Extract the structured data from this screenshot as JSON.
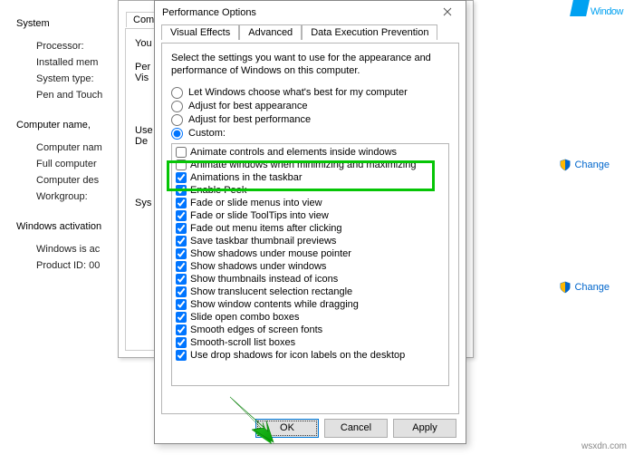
{
  "winlogo": "Window",
  "bg": {
    "system": "System",
    "rows1": [
      "Processor:",
      "Installed mem",
      "System type:",
      "Pen and Touch"
    ],
    "computer_name": "Computer name,",
    "rows2": [
      "Computer nam",
      "Full computer",
      "Computer des",
      "Workgroup:"
    ],
    "activation": "Windows activation",
    "rows3": [
      "Windows is ac",
      "Product ID:  00"
    ],
    "change": "Change"
  },
  "sys_props": {
    "tab": "Compu",
    "you": "You",
    "groups": [
      {
        "p1": "Per",
        "p2": "Vis"
      },
      {
        "p1": "Use",
        "p2": "De"
      },
      {
        "p1": "Sys"
      }
    ]
  },
  "perf": {
    "title": "Performance Options",
    "tabs": [
      "Visual Effects",
      "Advanced",
      "Data Execution Prevention"
    ],
    "desc": "Select the settings you want to use for the appearance and performance of Windows on this computer.",
    "radios": [
      "Let Windows choose what's best for my computer",
      "Adjust for best appearance",
      "Adjust for best performance",
      "Custom:"
    ],
    "selected_radio": 3,
    "options": [
      {
        "c": false,
        "t": "Animate controls and elements inside windows"
      },
      {
        "c": false,
        "t": "Animate windows when minimizing and maximizing"
      },
      {
        "c": true,
        "t": "Animations in the taskbar"
      },
      {
        "c": true,
        "t": "Enable Peek"
      },
      {
        "c": true,
        "t": "Fade or slide menus into view"
      },
      {
        "c": true,
        "t": "Fade or slide ToolTips into view"
      },
      {
        "c": true,
        "t": "Fade out menu items after clicking"
      },
      {
        "c": true,
        "t": "Save taskbar thumbnail previews"
      },
      {
        "c": true,
        "t": "Show shadows under mouse pointer"
      },
      {
        "c": true,
        "t": "Show shadows under windows"
      },
      {
        "c": true,
        "t": "Show thumbnails instead of icons"
      },
      {
        "c": true,
        "t": "Show translucent selection rectangle"
      },
      {
        "c": true,
        "t": "Show window contents while dragging"
      },
      {
        "c": true,
        "t": "Slide open combo boxes"
      },
      {
        "c": true,
        "t": "Smooth edges of screen fonts"
      },
      {
        "c": true,
        "t": "Smooth-scroll list boxes"
      },
      {
        "c": true,
        "t": "Use drop shadows for icon labels on the desktop"
      }
    ],
    "buttons": {
      "ok": "OK",
      "cancel": "Cancel",
      "apply": "Apply"
    }
  },
  "watermark": "wsxdn.com"
}
